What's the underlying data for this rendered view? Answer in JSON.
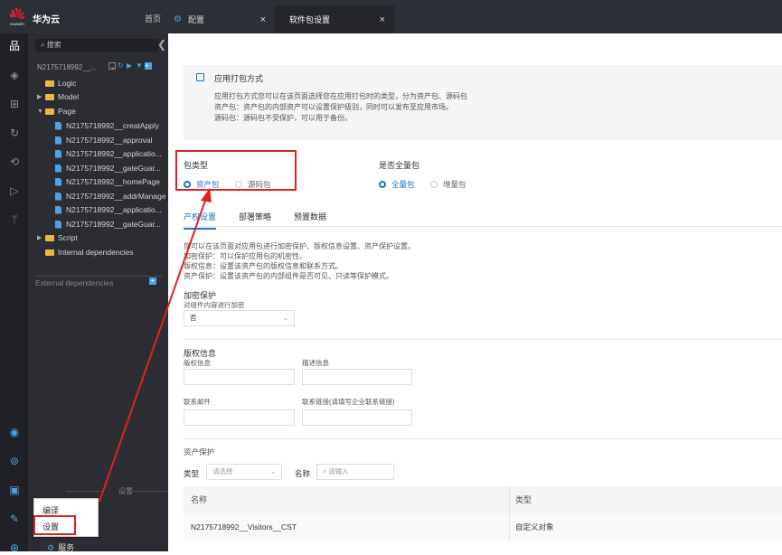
{
  "brand": {
    "name": "华为云",
    "home": "首页"
  },
  "tabs": [
    {
      "label": "配置",
      "close": "×"
    },
    {
      "label": "软件包设置",
      "close": "×"
    }
  ],
  "tree": {
    "search_placeholder": "搜索",
    "project": "N2175718992__...",
    "items": [
      {
        "label": "Logic"
      },
      {
        "label": "Model"
      },
      {
        "label": "Page"
      },
      {
        "label": "N2175718992__creatApply"
      },
      {
        "label": "N2175718992__approval"
      },
      {
        "label": "N2175718992__applicatio..."
      },
      {
        "label": "N2175718992__gateGuar..."
      },
      {
        "label": "N2175718992__homePage"
      },
      {
        "label": "N2175718992__addrManage"
      },
      {
        "label": "N2175718992__applicatio..."
      },
      {
        "label": "N2175718992__gateGuar..."
      },
      {
        "label": "Script"
      },
      {
        "label": "Internal dependencies"
      }
    ],
    "external": "External dependencies",
    "settings_header": "设置"
  },
  "context_menu": {
    "compile": "编译",
    "settings": "设置"
  },
  "service": "服务",
  "intro": {
    "title": "应用打包方式",
    "line1": "应用打包方式您可以在该页面选择您在应用打包时的类型，分为资产包、源码包",
    "line2": "资产包：资产包的内部资产可以设置保护级别，同时可以发布至应用市场。",
    "line3": "源码包：源码包不受保护，可以用于备份。"
  },
  "package_type": {
    "label": "包类型",
    "options": [
      "资产包",
      "源码包"
    ],
    "selected": "资产包"
  },
  "full_package": {
    "label": "是否全量包",
    "options": [
      "全量包",
      "增量包"
    ],
    "selected": "全量包"
  },
  "subtabs": [
    "产权设置",
    "部署策略",
    "预置数据"
  ],
  "desc": {
    "l1": "您可以在该页面对应用包进行加密保护、版权信息设置、资产保护设置。",
    "l2": "加密保护：可以保护应用包的机密性。",
    "l3": "版权信息：设置该资产包的版权信息和联系方式。",
    "l4": "资产保护：设置该资产包的内部组件是否可见、只读等保护模式。"
  },
  "encrypt": {
    "title": "加密保护",
    "label": "对组件内容进行加密",
    "value": "否"
  },
  "copyright": {
    "title": "版权信息",
    "copyright_label": "版权信息",
    "desc_label": "描述信息",
    "email_label": "联系邮件",
    "link_label": "联系链接(请填写企业联系链接)"
  },
  "asset": {
    "title": "资产保护",
    "type_label": "类型",
    "type_placeholder": "请选择",
    "name_label": "名称",
    "name_placeholder": "请输入",
    "col_name": "名称",
    "col_type": "类型",
    "row_name": "N2175718992__Visitors__CST",
    "row_type": "自定义对象"
  },
  "colors": {
    "accent": "#1a73c8",
    "annotation": "#e02020",
    "dark": "#2d2f36"
  }
}
